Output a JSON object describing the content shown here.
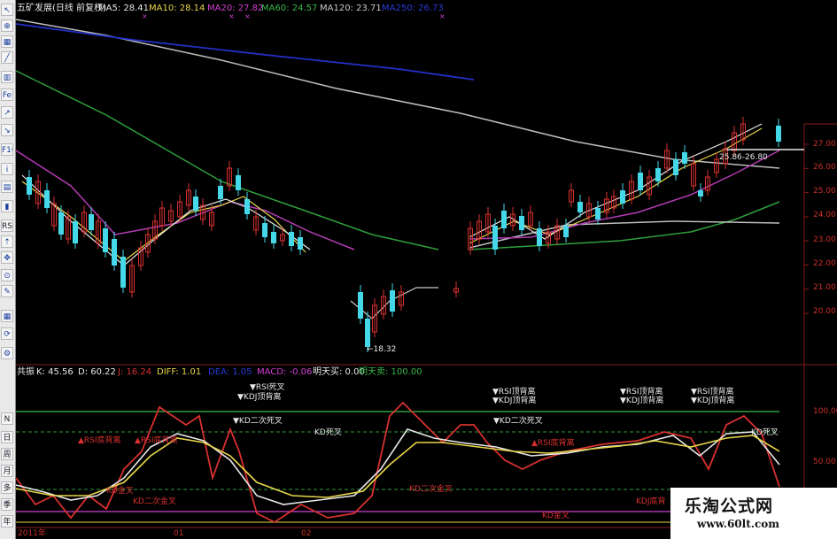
{
  "title": "五矿发展(日线 前复权)",
  "main_legend": [
    {
      "label": "MA5: 28.41",
      "color": "#e8e8e8"
    },
    {
      "label": "MA10: 28.14",
      "color": "#e8d64a"
    },
    {
      "label": "MA20: 27.82",
      "color": "#d040d0"
    },
    {
      "label": "MA60: 24.57",
      "color": "#39b84a"
    },
    {
      "label": "MA120: 23.71",
      "color": "#c9c9c9"
    },
    {
      "label": "MA250: 26.73",
      "color": "#2a3bd8"
    }
  ],
  "price_axis": [
    "27.00",
    "26.00",
    "25.00",
    "24.00",
    "23.00",
    "22.00",
    "21.00",
    "20.00"
  ],
  "price_markers": {
    "low": "←18.32",
    "level": "25.86-26.80"
  },
  "indicator_name": "共振",
  "indicator_legend": [
    {
      "label": "K: 45.56",
      "color": "#e8e8e8"
    },
    {
      "label": "D: 60.22",
      "color": "#e8e8e8"
    },
    {
      "label": "J: 16.24",
      "color": "#d83030"
    },
    {
      "label": "DIFF: 1.01",
      "color": "#e8d64a"
    },
    {
      "label": "DEA: 1.05",
      "color": "#2a3bd8"
    },
    {
      "label": "MACD: -0.06",
      "color": "#d040d0"
    },
    {
      "label": "明天买: 0.00",
      "color": "#e8e8e8"
    },
    {
      "label": "明天卖: 100.00",
      "color": "#39b84a"
    }
  ],
  "indicator_axis": [
    "100.00",
    "50.00"
  ],
  "signals": {
    "rsi_dead": "▼RSI死叉",
    "kdj_top": "▼KDJ顶背离",
    "kd_dead2": "▼KD二次死叉",
    "kd_dead": "KD死叉",
    "rsi_bottom": "▲RSI底背离",
    "kd_golden": "KD金叉",
    "kd_golden2": "KD二次金叉",
    "rsi_top": "▼RSI顶背离",
    "kdj_bottom": "KDJ底背"
  },
  "date_axis": [
    "2011年",
    "01",
    "02"
  ],
  "side_labels": [
    "RSI",
    "N",
    "日",
    "周",
    "月",
    "多",
    "季",
    "年"
  ],
  "watermark": {
    "title": "乐淘公式网",
    "url": "www.60lt.com"
  }
}
